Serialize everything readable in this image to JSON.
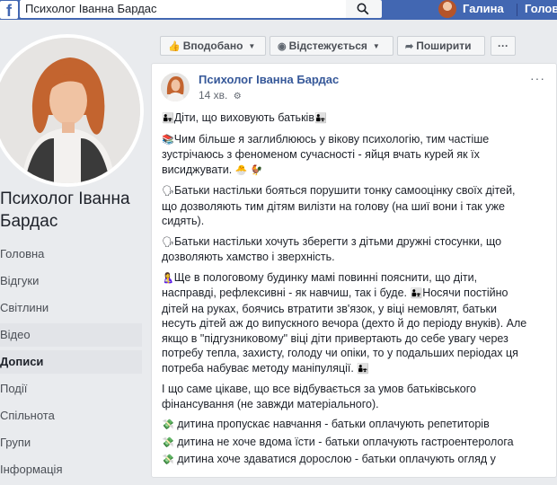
{
  "topbar": {
    "logo": "f",
    "search_value": "Психолог Іванна Бардас",
    "user_name": "Галина",
    "home_label": "Голов"
  },
  "page": {
    "name": "Психолог Іванна Бардас"
  },
  "nav": {
    "items": [
      "Головна",
      "Відгуки",
      "Світлини",
      "Відео",
      "Дописи",
      "Події",
      "Спільнота",
      "Групи",
      "Інформація"
    ]
  },
  "actions": {
    "liked": "Вподобано",
    "following": "Відстежується",
    "share": "Поширити",
    "more": "···"
  },
  "post": {
    "author": "Психолог Іванна Бардас",
    "time": "14 хв.",
    "menu": "···",
    "heading": "Діти, що виховують батьків",
    "p1": "Чим більше я заглиблююсь у вікову психологію, тим частіше зустрічаюсь з феноменом сучасності - яйця вчать курей як їх висиджувати.",
    "p2": "Батьки настільки бояться порушити тонку самооцінку своїх дітей, що дозволяють тим дітям вилізти на голову (на шиї вони і так уже сидять).",
    "p3": "Батьки настільки хочуть зберегти з дітьми дружні стосунки, що дозволяють хамство і зверхність.",
    "p4a": "Ще в пологовому будинку мамі повинні пояснити, що діти, насправді, рефлексивні - як навчиш, так і буде.",
    "p4b": "Носячи постійно дітей на руках, боячись втратити зв'язок, у віці немовлят, батьки несуть дітей аж до випускного вечора (дехто й до періоду внуків). Але якщо в \"підгузниковому\" віці діти привертають до себе увагу через потребу тепла, захисту, голоду чи опіки, то у подальших періодах ця потреба набуває методу маніпуляції.",
    "p5": "І що саме цікаве, що все відбувається за умов батьківського фінансування (не завжди матеріального).",
    "list": [
      "дитина пропускає навчання - батьки оплачують репетиторів",
      "дитина не хоче вдома їсти - батьки оплачують гастроентеролога",
      "дитина хоче здаватися дорослою - батьки оплачують огляд у"
    ]
  },
  "colors": {
    "brand": "#4267b2",
    "link": "#365899",
    "background": "#e9ebee"
  },
  "icons": [
    "facebook-logo-icon",
    "search-icon",
    "thumbs-up-icon",
    "rss-icon",
    "share-arrow-icon",
    "ellipsis-icon",
    "globe-icon"
  ]
}
